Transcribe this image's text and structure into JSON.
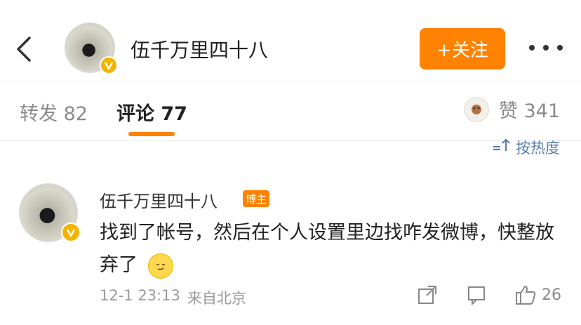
{
  "header": {
    "username": "伍千万里四十八",
    "follow_label": "+关注"
  },
  "tabs": {
    "repost": "转发 82",
    "comment": "评论 77",
    "like": "赞 341"
  },
  "sort_label": "按热度",
  "comment": {
    "author": "伍千万里四十八",
    "tag": "博主",
    "text": "找到了帐号，然后在个人设置里边找咋发微博，快整放弃了",
    "time": "12-1 23:13",
    "source": "来自北京",
    "like_count": "26"
  },
  "colors": {
    "accent": "#ff8200",
    "verified": "#f5b300",
    "link": "#5a7fb0"
  }
}
